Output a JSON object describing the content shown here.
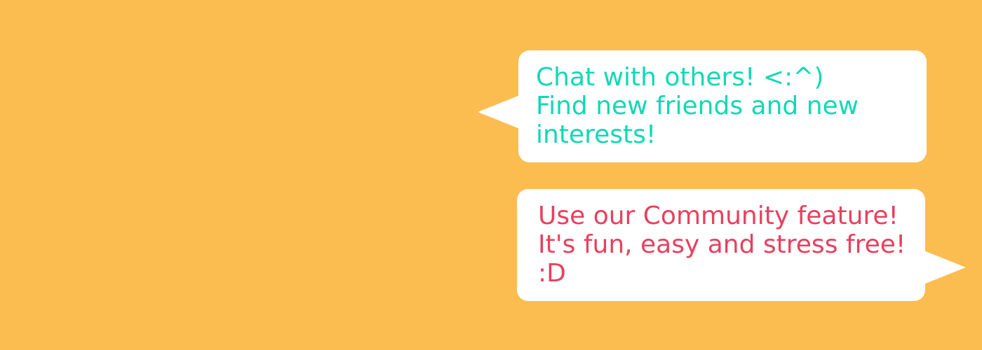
{
  "colors": {
    "background": "#FBBD50",
    "bubble": "#FFFFFF",
    "bubble_1_text": "#10D9B4",
    "bubble_2_text": "#E8405E"
  },
  "bubbles": [
    {
      "lines": [
        "Chat with others! <:^)",
        "Find new friends and new",
        "interests!"
      ]
    },
    {
      "lines": [
        "Use our Community feature!",
        "It's fun, easy and stress free!",
        ":D"
      ]
    }
  ]
}
